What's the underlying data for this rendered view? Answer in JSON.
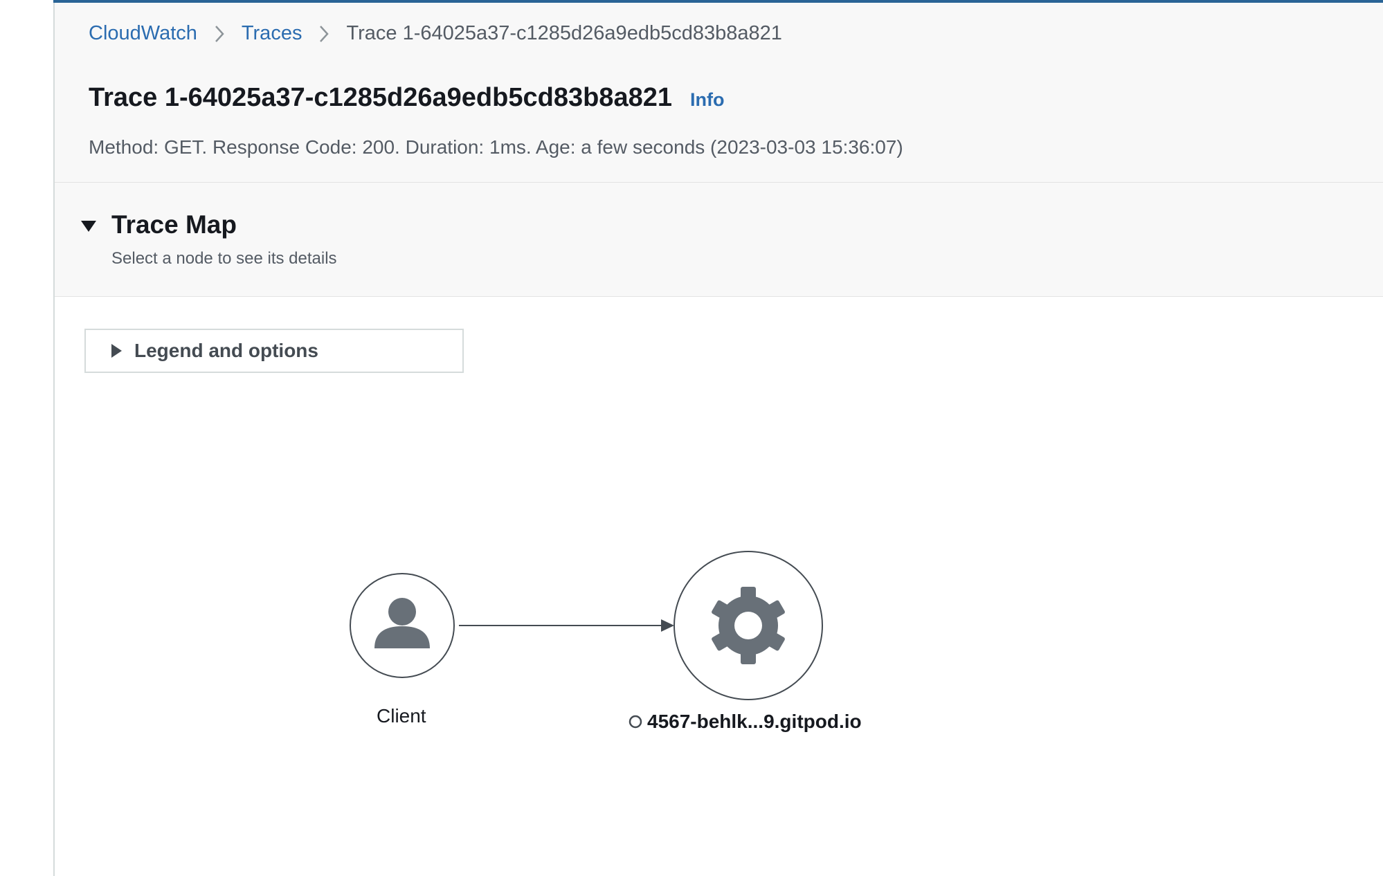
{
  "breadcrumb": {
    "items": [
      "CloudWatch",
      "Traces"
    ],
    "current": "Trace 1-64025a37-c1285d26a9edb5cd83b8a821"
  },
  "page": {
    "title": "Trace 1-64025a37-c1285d26a9edb5cd83b8a821",
    "info_label": "Info",
    "subtitle": "Method: GET. Response Code: 200. Duration: 1ms. Age: a few seconds (2023-03-03 15:36:07)"
  },
  "trace_map": {
    "title": "Trace Map",
    "description": "Select a node to see its details",
    "legend_label": "Legend and options",
    "nodes": [
      {
        "label": "Client",
        "icon": "user-icon"
      },
      {
        "label": "4567-behlk...9.gitpod.io",
        "icon": "gear-icon",
        "status_icon": "circle-outline-icon"
      }
    ]
  },
  "colors": {
    "link": "#2b6cb0",
    "icon_gray": "#687078",
    "accent_top": "#2a6496"
  }
}
